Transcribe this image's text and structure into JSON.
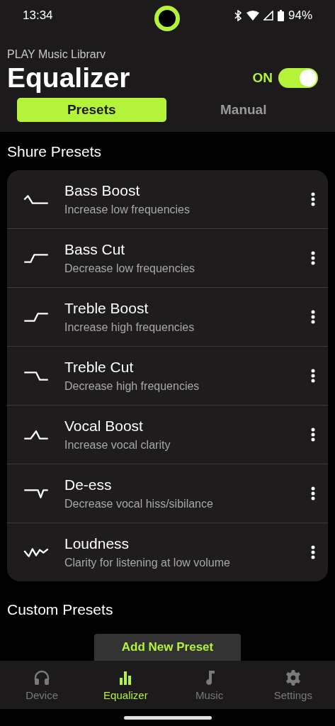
{
  "status_bar": {
    "time": "13:34",
    "battery": "94%"
  },
  "header": {
    "subtitle": "PLAY Music Librarv",
    "title": "Equalizer",
    "toggle_label": "ON",
    "on": true
  },
  "tabs": [
    {
      "label": "Presets",
      "selected": true
    },
    {
      "label": "Manual",
      "selected": false
    }
  ],
  "shure_presets": {
    "title": "Shure Presets",
    "items": [
      {
        "name": "Bass Boost",
        "description": "Increase low frequencies"
      },
      {
        "name": "Bass Cut",
        "description": "Decrease low frequencies"
      },
      {
        "name": "Treble Boost",
        "description": "Increase high frequencies"
      },
      {
        "name": "Treble Cut",
        "description": "Decrease high frequencies"
      },
      {
        "name": "Vocal Boost",
        "description": "Increase vocal clarity"
      },
      {
        "name": "De-ess",
        "description": "Decrease vocal hiss/sibilance"
      },
      {
        "name": "Loudness",
        "description": "Clarity for listening at low volume"
      }
    ]
  },
  "custom_presets": {
    "title": "Custom Presets",
    "add_button": "Add New Preset"
  },
  "bottom_nav": [
    {
      "label": "Device",
      "kind": "headphones",
      "selected": false
    },
    {
      "label": "Equalizer",
      "kind": "bars",
      "selected": true
    },
    {
      "label": "Music",
      "kind": "note",
      "selected": false
    },
    {
      "label": "Settings",
      "kind": "gear",
      "selected": false
    }
  ]
}
